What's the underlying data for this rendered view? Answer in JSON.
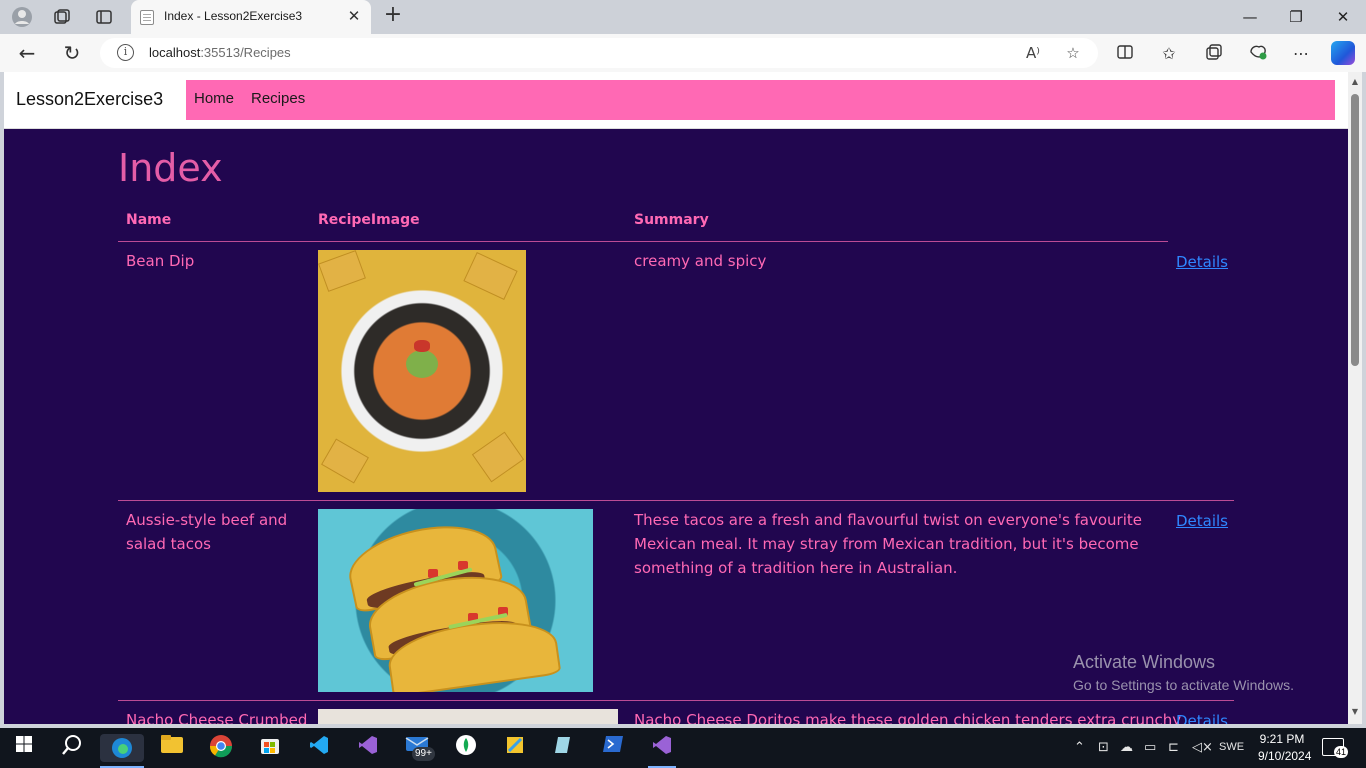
{
  "browser": {
    "tab_title": "Index - Lesson2Exercise3",
    "url_host": "localhost",
    "url_path": ":35513/Recipes",
    "new_tab_symbol": "+",
    "icons": [
      "profile-icon",
      "workspaces-icon",
      "tab-actions-icon",
      "back-icon",
      "refresh-icon",
      "site-info-icon",
      "read-aloud-icon",
      "favorite-star-icon",
      "split-screen-icon",
      "favorites-icon",
      "collections-icon",
      "browser-essentials-icon",
      "more-icon",
      "copilot-icon"
    ]
  },
  "site": {
    "brand": "Lesson2Exercise3",
    "nav": [
      {
        "label": "Home"
      },
      {
        "label": "Recipes"
      }
    ],
    "title": "Index"
  },
  "table": {
    "headers": {
      "name": "Name",
      "image": "RecipeImage",
      "summary": "Summary"
    },
    "details_label": "Details",
    "rows": [
      {
        "name": "Bean Dip",
        "image": "bean-dip-photo",
        "summary": "creamy and spicy"
      },
      {
        "name": "Aussie-style beef and salad tacos",
        "image": "beef-tacos-photo",
        "summary": "These tacos are a fresh and flavourful twist on everyone's favourite Mexican meal. It may stray from Mexican tradition, but it's become something of a tradition here in Australian."
      },
      {
        "name": "Nacho Cheese Crumbed",
        "image": "nacho-tenders-photo",
        "summary": "Nacho Cheese Doritos make these golden chicken tenders extra crunchy"
      }
    ]
  },
  "watermark": {
    "line1": "Activate Windows",
    "line2": "Go to Settings to activate Windows."
  },
  "taskbar": {
    "mail_badge": "99+",
    "language": "SWE",
    "time": "9:21 PM",
    "date": "9/10/2024",
    "notification_count": "41"
  }
}
